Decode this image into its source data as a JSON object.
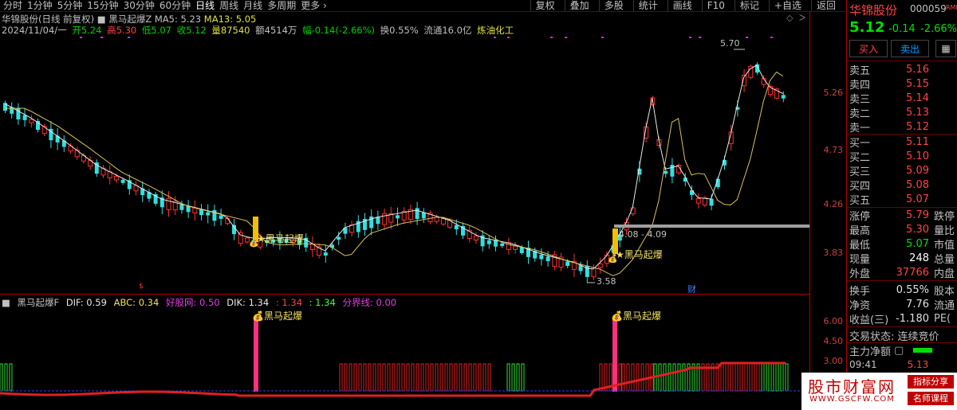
{
  "toolbar": {
    "tabs": [
      "分时",
      "1分钟",
      "5分钟",
      "15分钟",
      "30分钟",
      "60分钟",
      "日线",
      "周线",
      "月线",
      "多周期",
      "更多 ›"
    ],
    "right_buttons": [
      "复权",
      "叠加",
      "多股",
      "统计",
      "画线",
      "F10",
      "标记",
      "+自选",
      "返回"
    ]
  },
  "header": {
    "stock": "华锦股份(日线 前复权)",
    "indicator": "黑马起爆Z",
    "ma5": "MA5: 5.23",
    "ma13": "MA13: 5.05",
    "date": "2024/11/04/一",
    "open": "开5.24",
    "high": "高5.30",
    "low": "低5.07",
    "close": "收5.12",
    "volume": "量87540",
    "amount": "额4514万",
    "change": "幅-0.14(-2.66%)",
    "turnover": "换0.55%",
    "float": "流通16.0亿",
    "sector": "炼油化工"
  },
  "annotations": {
    "high_marker": "5.70",
    "low_marker": "3.58",
    "range_label": "4.08 - 4.09",
    "signal1": "黑马起爆",
    "signal2": "黑马起爆",
    "cai": "财",
    "sub_signal1": "黑马起爆",
    "sub_signal2": "黑马起爆"
  },
  "axis": {
    "main": [
      "5.26",
      "4.73",
      "4.26",
      "3.83"
    ],
    "sub": [
      "6.00",
      "4.50",
      "3.00"
    ]
  },
  "sub_header": {
    "name": "黑马起爆F",
    "dif": "DIF: 0.59",
    "abc": "ABC: 0.34",
    "haogu": "好股网: 0.50",
    "dik": "DIK: 1.34",
    "v1": ": 1.34",
    "v2": ": 1.34",
    "fenjie": "分界线: 0.00"
  },
  "panel": {
    "name": "华锦股份",
    "code": "000059",
    "price": "5.12",
    "change": "-0.14",
    "pct": "-2.66%",
    "buy_btn": "买入",
    "sell_btn": "卖出",
    "asks": [
      {
        "label": "卖五",
        "price": "5.16"
      },
      {
        "label": "卖四",
        "price": "5.15"
      },
      {
        "label": "卖三",
        "price": "5.14"
      },
      {
        "label": "卖二",
        "price": "5.13"
      },
      {
        "label": "卖一",
        "price": "5.12"
      }
    ],
    "bids": [
      {
        "label": "买一",
        "price": "5.11"
      },
      {
        "label": "买二",
        "price": "5.10"
      },
      {
        "label": "买三",
        "price": "5.09"
      },
      {
        "label": "买四",
        "price": "5.08"
      },
      {
        "label": "买五",
        "price": "5.07"
      }
    ],
    "stats": [
      {
        "label": "涨停",
        "value": "5.79",
        "extra": "跌停"
      },
      {
        "label": "最高",
        "value": "5.30",
        "extra": "量比"
      },
      {
        "label": "最低",
        "value": "5.07",
        "extra": "市值"
      },
      {
        "label": "现量",
        "value": "248",
        "extra": "总量"
      },
      {
        "label": "外盘",
        "value": "37766",
        "extra": "内盘"
      }
    ],
    "stats2": [
      {
        "label": "换手",
        "value": "0.55%",
        "extra": "股本"
      },
      {
        "label": "净资",
        "value": "7.76",
        "extra": "流通"
      },
      {
        "label": "收益(三)",
        "value": "-1.180",
        "extra": "PE("
      }
    ],
    "trade_status": "交易状态: 连续竞价",
    "main_flow": "主力净额",
    "time": "09:41",
    "time_price": "5.13"
  },
  "watermark": {
    "title": "股市财富网",
    "url": "WWW.GSCFW.COM",
    "tag1": "指标分享",
    "tag2": "名师课程"
  }
}
